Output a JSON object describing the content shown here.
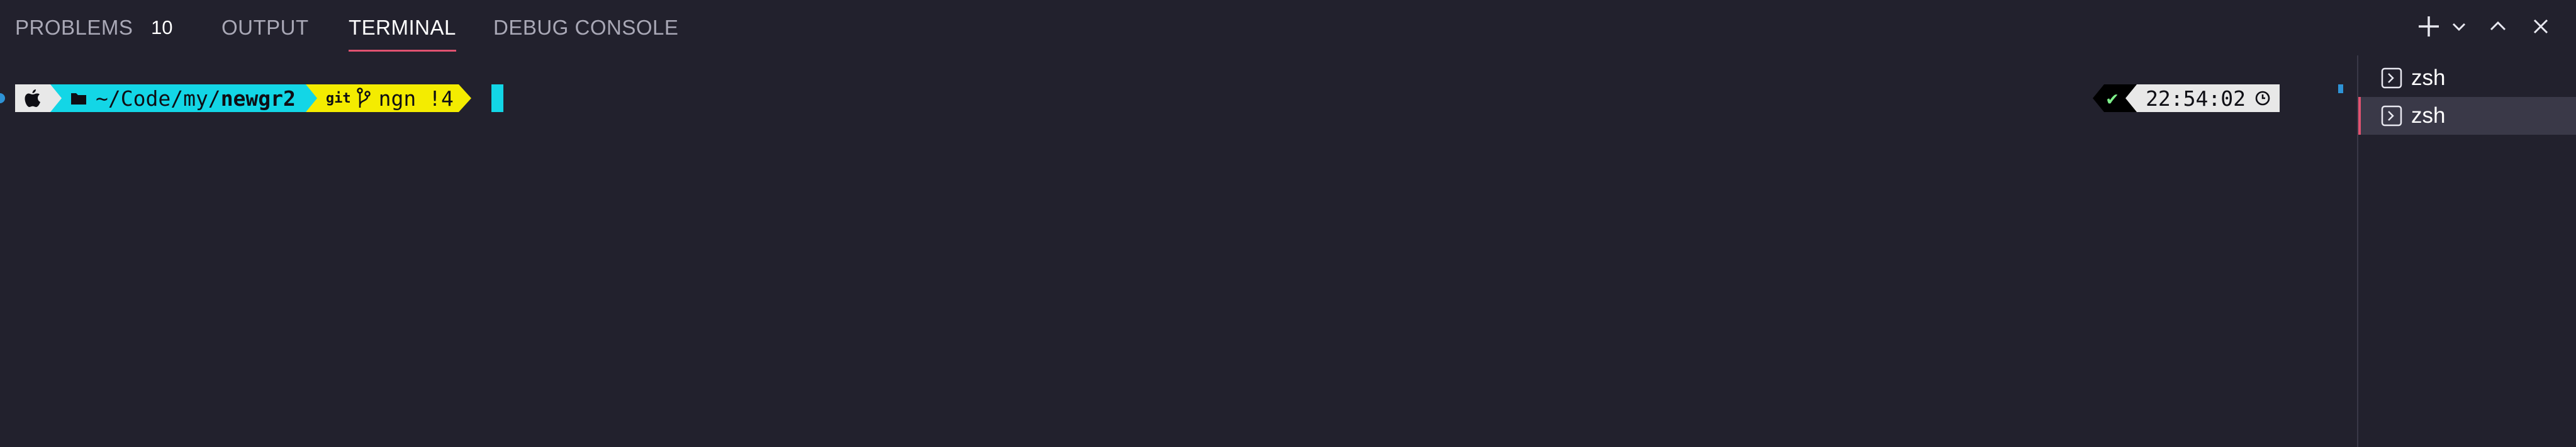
{
  "tabs": [
    {
      "label": "PROBLEMS",
      "count": "10",
      "active": false
    },
    {
      "label": "OUTPUT",
      "active": false
    },
    {
      "label": "TERMINAL",
      "active": true
    },
    {
      "label": "DEBUG CONSOLE",
      "active": false
    }
  ],
  "actions": {
    "new_terminal": "plus-icon",
    "launch_profile": "chevron-down-icon",
    "maximize": "chevron-up-icon",
    "close": "close-icon"
  },
  "terminal": {
    "prompt": {
      "os_icon": "apple-icon",
      "folder_icon": "folder-icon",
      "path": "~/Code/my/",
      "path_bold": "newgr2",
      "vcs_label": "git",
      "branch_icon": "branch-icon",
      "branch": "ngn !4"
    },
    "right_prompt": {
      "status": "✔",
      "time": "22:54:02",
      "clock_icon": "clock-icon"
    }
  },
  "terminal_list": [
    {
      "label": "zsh",
      "icon": "terminal-icon",
      "selected": false
    },
    {
      "label": "zsh",
      "icon": "terminal-icon",
      "selected": true
    }
  ],
  "colors": {
    "background": "#22212d",
    "accent": "#e05270",
    "cyan": "#13d6e6",
    "yellow": "#f4ec00",
    "light_segment": "#e8e8e8",
    "status_ok": "#7ef08a"
  }
}
